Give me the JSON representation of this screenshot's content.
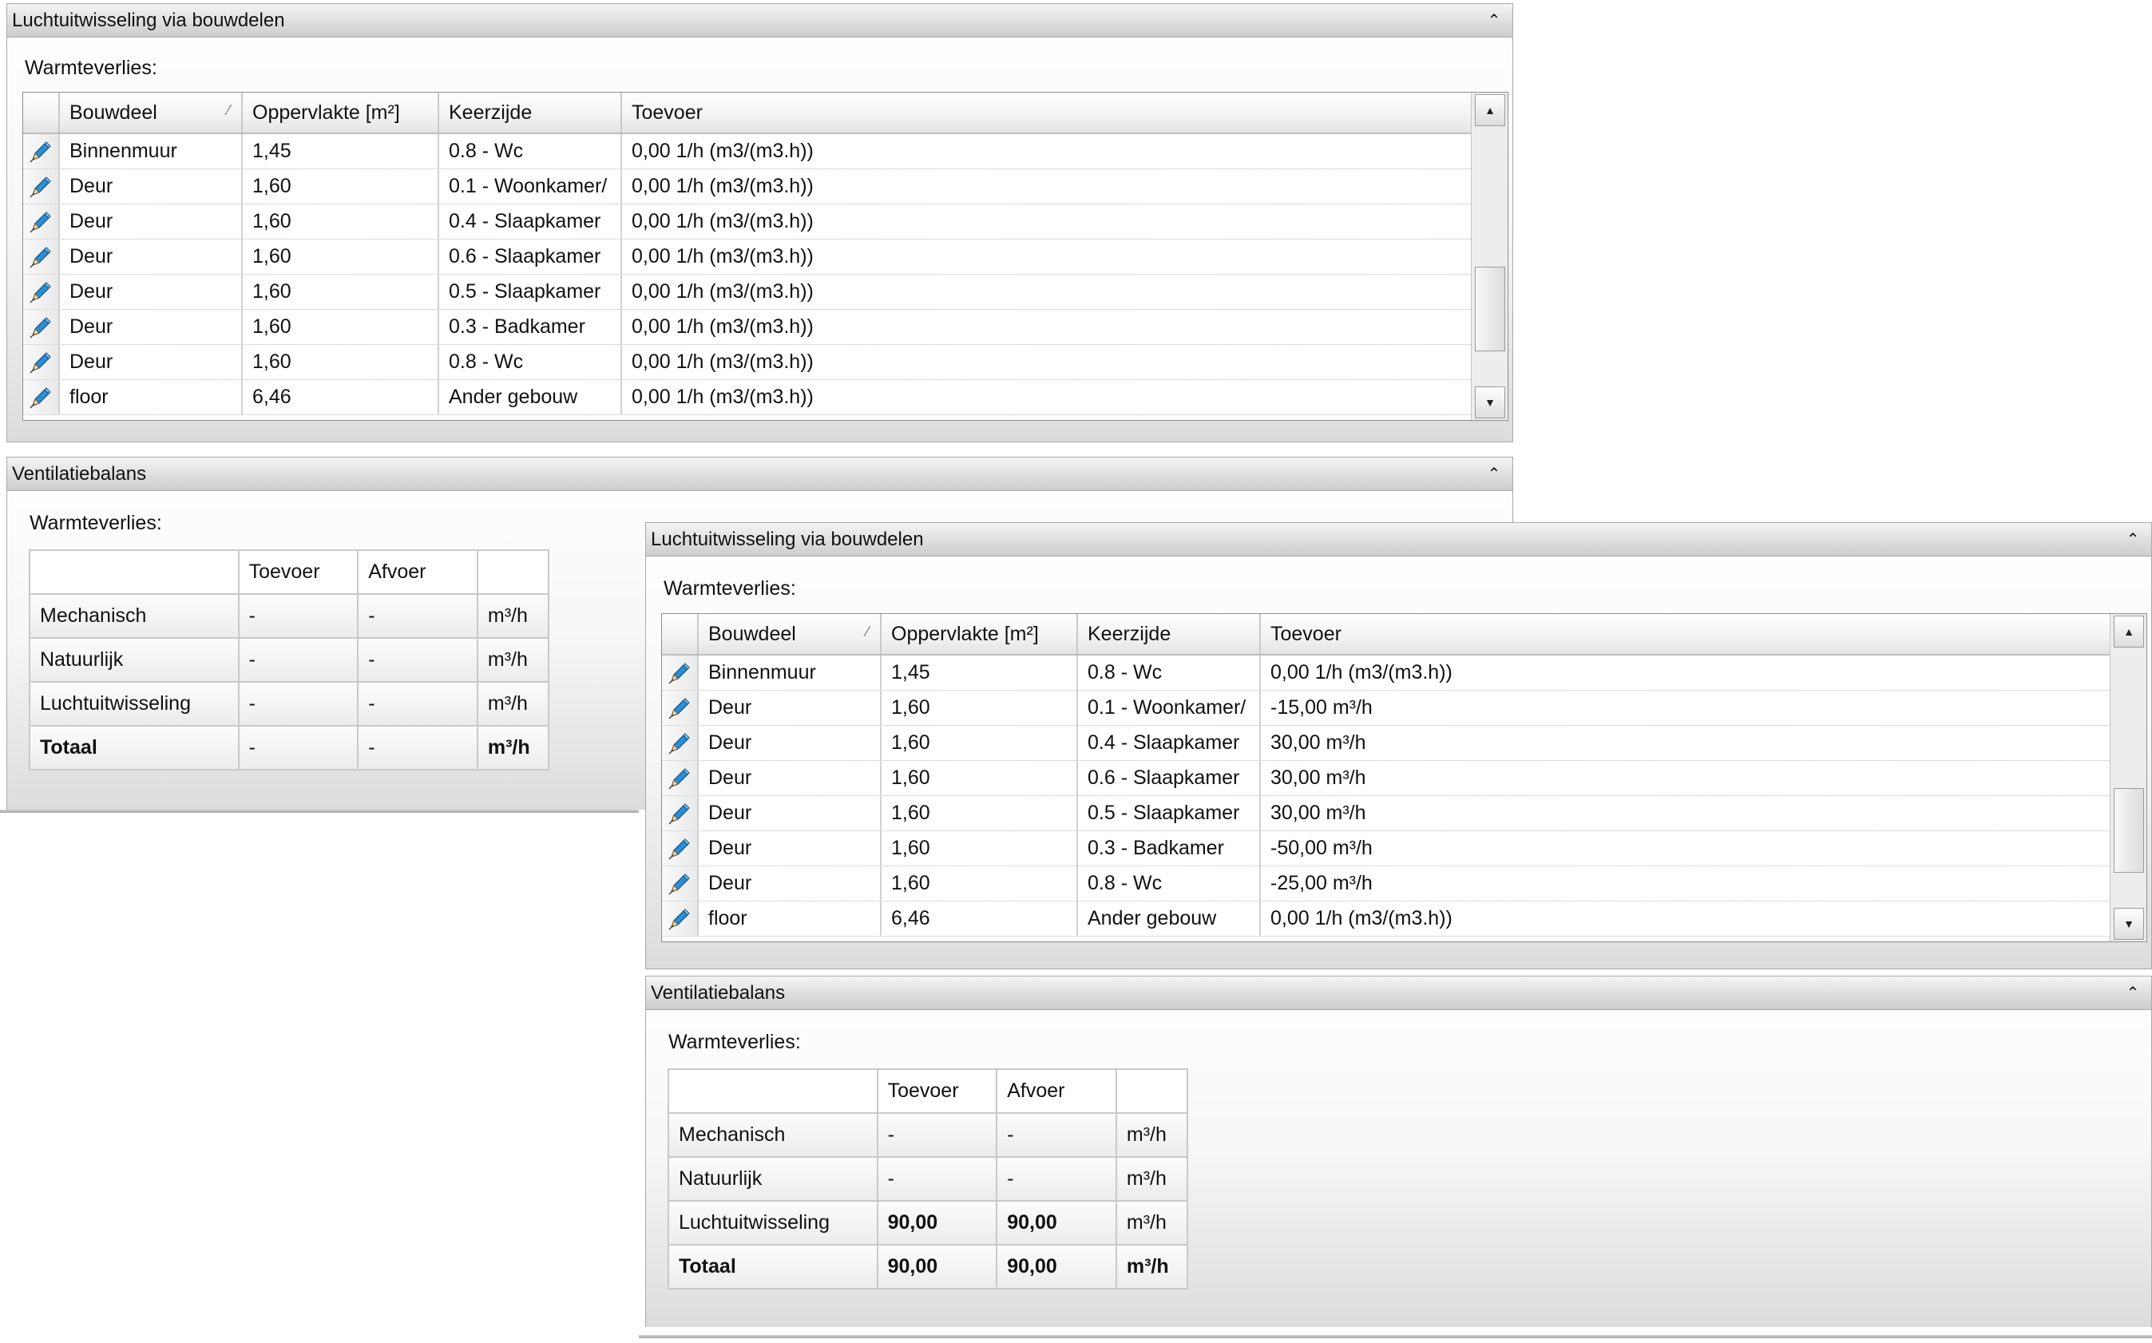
{
  "left": {
    "panel1": {
      "title": "Luchtuitwisseling via bouwdelen",
      "section_label": "Warmteverlies:",
      "columns": [
        "Bouwdeel",
        "Oppervlakte [m²]",
        "Keerzijde",
        "Toevoer"
      ],
      "rows": [
        [
          "Binnenmuur",
          "1,45",
          "0.8 - Wc",
          "0,00 1/h (m3/(m3.h))"
        ],
        [
          "Deur",
          "1,60",
          "0.1 - Woonkamer/",
          "0,00 1/h (m3/(m3.h))"
        ],
        [
          "Deur",
          "1,60",
          "0.4 - Slaapkamer",
          "0,00 1/h (m3/(m3.h))"
        ],
        [
          "Deur",
          "1,60",
          "0.6 - Slaapkamer",
          "0,00 1/h (m3/(m3.h))"
        ],
        [
          "Deur",
          "1,60",
          "0.5 - Slaapkamer",
          "0,00 1/h (m3/(m3.h))"
        ],
        [
          "Deur",
          "1,60",
          "0.3 - Badkamer",
          "0,00 1/h (m3/(m3.h))"
        ],
        [
          "Deur",
          "1,60",
          "0.8 - Wc",
          "0,00 1/h (m3/(m3.h))"
        ],
        [
          "floor",
          "6,46",
          "Ander gebouw",
          "0,00 1/h (m3/(m3.h))"
        ]
      ]
    },
    "panel2": {
      "title": "Ventilatiebalans",
      "section_label": "Warmteverlies:",
      "headers": [
        "",
        "Toevoer",
        "Afvoer",
        ""
      ],
      "rows": [
        [
          "Mechanisch",
          "-",
          "-",
          "m³/h"
        ],
        [
          "Natuurlijk",
          "-",
          "-",
          "m³/h"
        ],
        [
          "Luchtuitwisseling",
          "-",
          "-",
          "m³/h"
        ],
        [
          "Totaal",
          "-",
          "-",
          "m³/h"
        ]
      ]
    }
  },
  "right": {
    "panel1": {
      "title": "Luchtuitwisseling via bouwdelen",
      "section_label": "Warmteverlies:",
      "columns": [
        "Bouwdeel",
        "Oppervlakte [m²]",
        "Keerzijde",
        "Toevoer"
      ],
      "rows": [
        [
          "Binnenmuur",
          "1,45",
          "0.8 - Wc",
          "0,00 1/h (m3/(m3.h))"
        ],
        [
          "Deur",
          "1,60",
          "0.1 - Woonkamer/",
          "-15,00 m³/h"
        ],
        [
          "Deur",
          "1,60",
          "0.4 - Slaapkamer",
          "30,00 m³/h"
        ],
        [
          "Deur",
          "1,60",
          "0.6 - Slaapkamer",
          "30,00 m³/h"
        ],
        [
          "Deur",
          "1,60",
          "0.5 - Slaapkamer",
          "30,00 m³/h"
        ],
        [
          "Deur",
          "1,60",
          "0.3 - Badkamer",
          "-50,00 m³/h"
        ],
        [
          "Deur",
          "1,60",
          "0.8 - Wc",
          "-25,00 m³/h"
        ],
        [
          "floor",
          "6,46",
          "Ander gebouw",
          "0,00 1/h (m3/(m3.h))"
        ]
      ]
    },
    "panel2": {
      "title": "Ventilatiebalans",
      "section_label": "Warmteverlies:",
      "headers": [
        "",
        "Toevoer",
        "Afvoer",
        ""
      ],
      "rows": [
        [
          "Mechanisch",
          "-",
          "-",
          "m³/h"
        ],
        [
          "Natuurlijk",
          "-",
          "-",
          "m³/h"
        ],
        [
          "Luchtuitwisseling",
          "90,00",
          "90,00",
          "m³/h"
        ],
        [
          "Totaal",
          "90,00",
          "90,00",
          "m³/h"
        ]
      ]
    }
  },
  "icons": {
    "row_edit": "pencil-icon",
    "collapse": "double-chevron-up-icon",
    "sort": "sort-indicator-icon",
    "scroll_up": "scroll-up-arrow-icon",
    "scroll_down": "scroll-down-arrow-icon"
  },
  "colors": {
    "pencil_blue": "#2a8fd6",
    "border": "#a9a9a9",
    "header_bg": "#dedede"
  }
}
